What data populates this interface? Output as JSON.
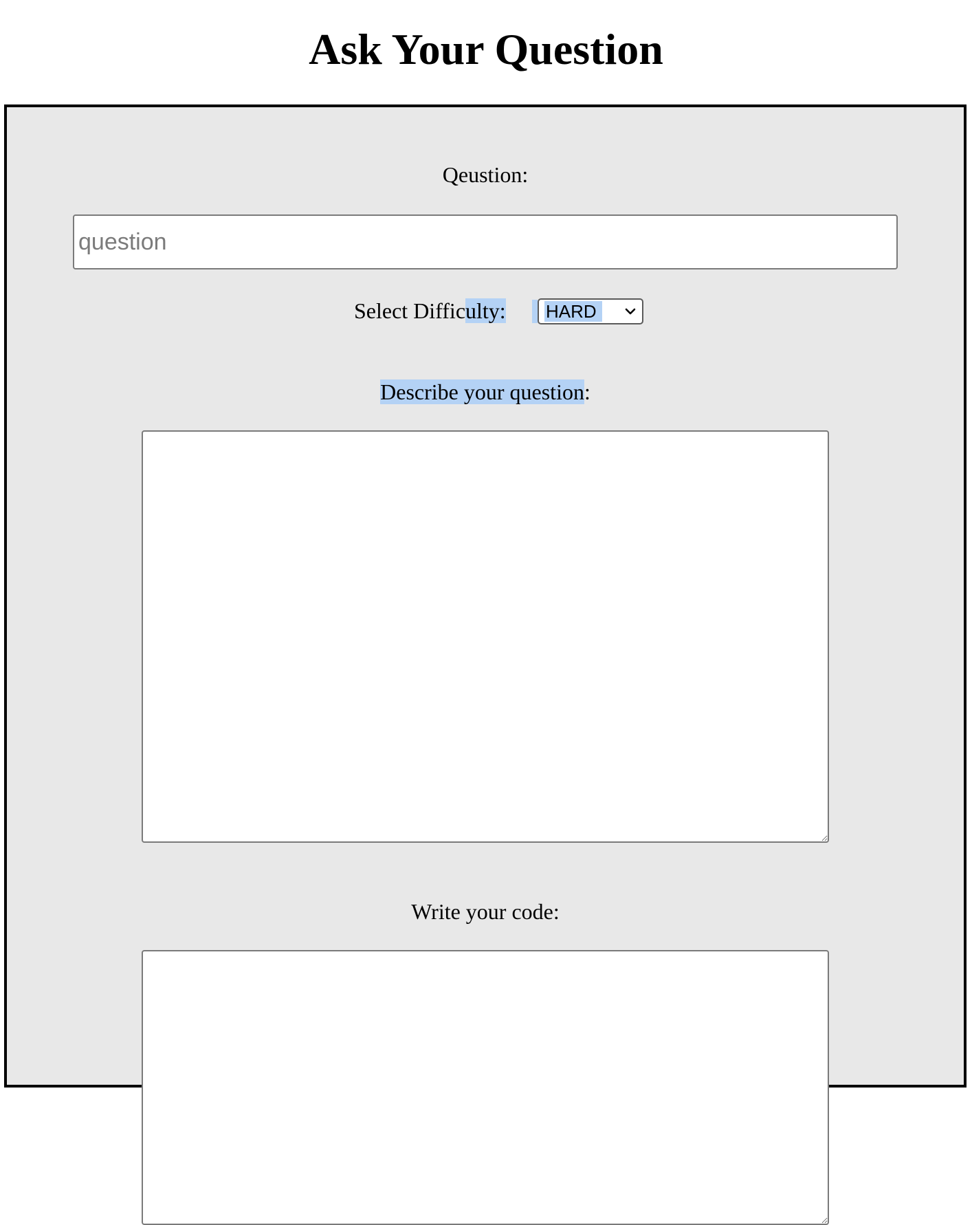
{
  "header": {
    "title": "Ask Your Question"
  },
  "form": {
    "question_label": "Qeustion:",
    "question_placeholder": "question",
    "question_value": "",
    "difficulty_label_start": "Select Diffic",
    "difficulty_label_highlighted": "ulty:",
    "difficulty_selected": "HARD",
    "description_label_highlighted": "Describe your question",
    "description_label_end": ":",
    "description_value": "",
    "code_label": "Write your code:",
    "code_value": ""
  },
  "colors": {
    "panel_background": "#e8e8e8",
    "selection_highlight": "#b4d2f5",
    "border": "#000000"
  },
  "icons": {
    "select_arrow": "chevron-down-icon"
  }
}
